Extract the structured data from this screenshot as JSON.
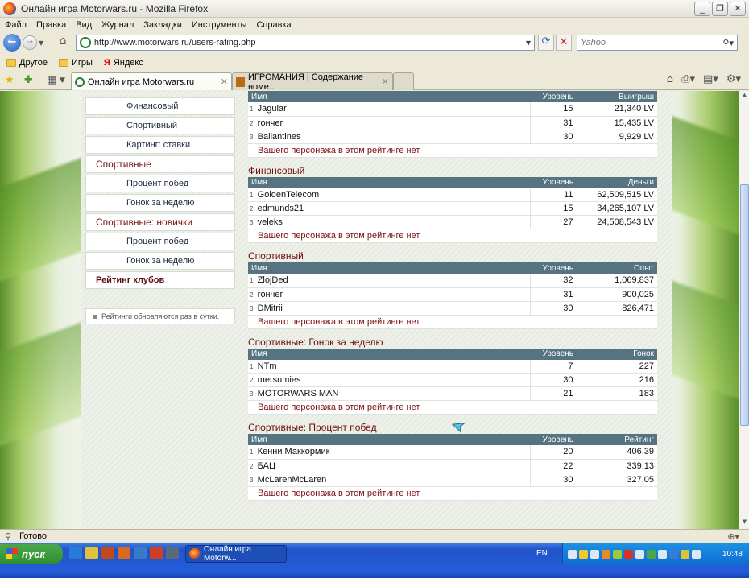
{
  "window": {
    "title": "Онлайн игра Motorwars.ru - Mozilla Firefox"
  },
  "menu": [
    "Файл",
    "Правка",
    "Вид",
    "Журнал",
    "Закладки",
    "Инструменты",
    "Справка"
  ],
  "nav": {
    "url": "http://www.motorwars.ru/users-rating.php",
    "search_placeholder": "Yahoo"
  },
  "bookmarks": [
    "Другое",
    "Игры",
    "Яндекс"
  ],
  "tabs": [
    {
      "label": "Онлайн игра Motorwars.ru",
      "active": true
    },
    {
      "label": "ИГРОМАНИЯ | Содержание номе...",
      "active": false
    }
  ],
  "sidebar": {
    "items": [
      {
        "label": "Финансовый",
        "type": "item"
      },
      {
        "label": "Спортивный",
        "type": "item"
      },
      {
        "label": "Картинг: ставки",
        "type": "item"
      },
      {
        "label": "Спортивные",
        "type": "head"
      },
      {
        "label": "Процент побед",
        "type": "item"
      },
      {
        "label": "Гонок за неделю",
        "type": "item"
      },
      {
        "label": "Спортивные: новички",
        "type": "head"
      },
      {
        "label": "Процент побед",
        "type": "item"
      },
      {
        "label": "Гонок за неделю",
        "type": "item"
      },
      {
        "label": "Рейтинг клубов",
        "type": "bold"
      }
    ],
    "note": "Рейтинги обновляются раз в сутки."
  },
  "sections": [
    {
      "title": "",
      "columns": [
        "Имя",
        "Уровень",
        "Выигрыш"
      ],
      "rows": [
        {
          "num": "1.",
          "name": "Jagular",
          "level": "15",
          "value": "21,340 LV"
        },
        {
          "num": "2.",
          "name": "гончег",
          "level": "31",
          "value": "15,435 LV"
        },
        {
          "num": "3.",
          "name": "Ballantines",
          "level": "30",
          "value": "9,929 LV"
        }
      ],
      "none_text": "Вашего персонажа в этом рейтинге нет"
    },
    {
      "title": "Финансовый",
      "columns": [
        "Имя",
        "Уровень",
        "Деньги"
      ],
      "rows": [
        {
          "num": "1.",
          "name": "GoldenTelecom",
          "level": "11",
          "value": "62,509,515 LV"
        },
        {
          "num": "2.",
          "name": "edmunds21",
          "level": "15",
          "value": "34,265,107 LV"
        },
        {
          "num": "3.",
          "name": "veleks",
          "level": "27",
          "value": "24,508,543 LV"
        }
      ],
      "none_text": "Вашего персонажа в этом рейтинге нет"
    },
    {
      "title": "Спортивный",
      "columns": [
        "Имя",
        "Уровень",
        "Опыт"
      ],
      "rows": [
        {
          "num": "1.",
          "name": "ZlojDed",
          "level": "32",
          "value": "1,069,837"
        },
        {
          "num": "2.",
          "name": "гончег",
          "level": "31",
          "value": "900,025"
        },
        {
          "num": "3.",
          "name": "DMitrii",
          "level": "30",
          "value": "826,471"
        }
      ],
      "none_text": "Вашего персонажа в этом рейтинге нет"
    },
    {
      "title": "Спортивные: Гонок за неделю",
      "columns": [
        "Имя",
        "Уровень",
        "Гонок"
      ],
      "rows": [
        {
          "num": "1.",
          "name": "NTm",
          "level": "7",
          "value": "227"
        },
        {
          "num": "2.",
          "name": "mersumies",
          "level": "30",
          "value": "216"
        },
        {
          "num": "3.",
          "name": "MOTORWARS MAN",
          "level": "21",
          "value": "183"
        }
      ],
      "none_text": "Вашего персонажа в этом рейтинге нет"
    },
    {
      "title": "Спортивные: Процент побед",
      "columns": [
        "Имя",
        "Уровень",
        "Рейтинг"
      ],
      "rows": [
        {
          "num": "1.",
          "name": "Кенни Маккормик",
          "level": "20",
          "value": "406.39"
        },
        {
          "num": "2.",
          "name": "БАЦ",
          "level": "22",
          "value": "339.13"
        },
        {
          "num": "3.",
          "name": "McLarenMcLaren",
          "level": "30",
          "value": "327.05"
        }
      ],
      "none_text": "Вашего персонажа в этом рейтинге нет"
    }
  ],
  "status": {
    "text": "Готово"
  },
  "taskbar": {
    "start": "пуск",
    "task": "Онлайн игра Motorw...",
    "lang": "EN",
    "clock": "10:48"
  },
  "colors": {
    "header": "#557380",
    "accent": "#6e0e0e",
    "taskbar": "#245edb"
  }
}
